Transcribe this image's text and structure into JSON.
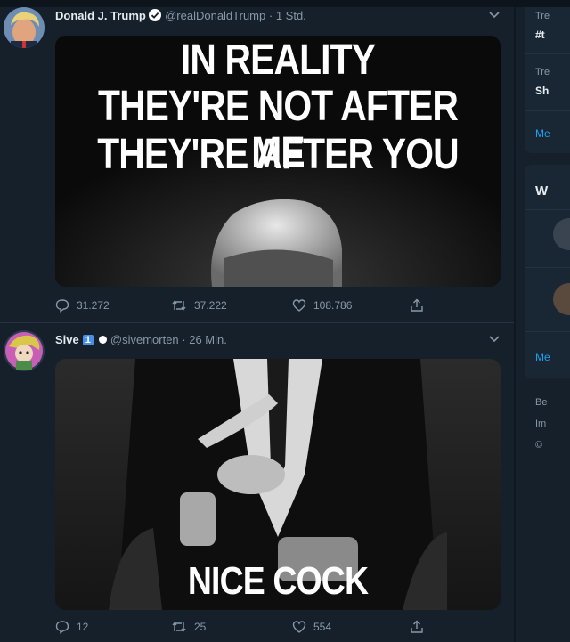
{
  "tweets": [
    {
      "name": "Donald J. Trump",
      "handle": "@realDonaldTrump",
      "time": "· 1 Std.",
      "meme_lines": [
        "IN REALITY",
        "THEY'RE NOT AFTER ME",
        "THEY'RE AFTER YOU"
      ],
      "replies": "31.272",
      "retweets": "37.222",
      "likes": "108.786"
    },
    {
      "name": "Sive",
      "badge": "1",
      "handle": "@sivemorten",
      "time": "· 26 Min.",
      "meme_caption": "NICE COCK",
      "replies": "12",
      "retweets": "25",
      "likes": "554"
    }
  ],
  "sidebar": {
    "trend1_label": "Tre",
    "trend1_tag": "#t",
    "trend2_label": "Tre",
    "trend2_tag": "Sh",
    "show_more_1": "Me",
    "follow_heading": "W",
    "show_more_2": "Me",
    "footer_1": "Be",
    "footer_2": "Im",
    "footer_3": "©"
  }
}
